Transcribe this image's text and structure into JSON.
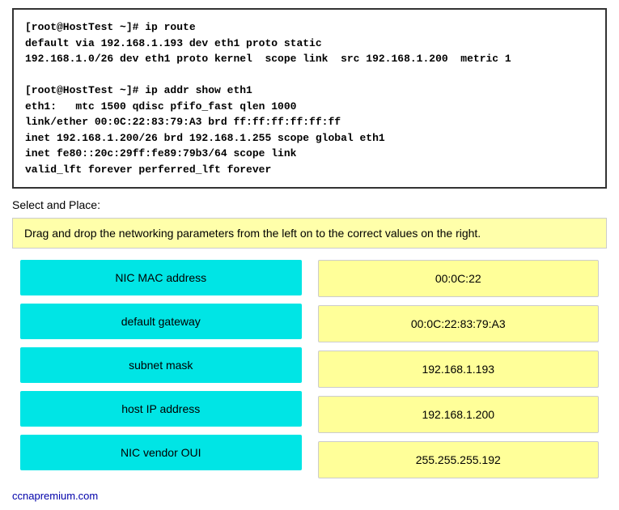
{
  "terminal": {
    "content": "[root@HostTest ~]# ip route\ndefault via 192.168.1.193 dev eth1 proto static\n192.168.1.0/26 dev eth1 proto kernel  scope link  src 192.168.1.200  metric 1\n\n[root@HostTest ~]# ip addr show eth1\neth1:   mtc 1500 qdisc pfifo_fast qlen 1000\nlink/ether 00:0C:22:83:79:A3 brd ff:ff:ff:ff:ff:ff\ninet 192.168.1.200/26 brd 192.168.1.255 scope global eth1\ninet fe80::20c:29ff:fe89:79b3/64 scope link\nvalid_lft forever perferred_lft forever"
  },
  "select_place_label": "Select and Place:",
  "instruction": "Drag and drop the networking parameters from the left on to the correct values on the right.",
  "left_items": [
    {
      "id": "nic-mac",
      "label": "NIC MAC address"
    },
    {
      "id": "default-gateway",
      "label": "default gateway"
    },
    {
      "id": "subnet-mask",
      "label": "subnet mask"
    },
    {
      "id": "host-ip",
      "label": "host IP address"
    },
    {
      "id": "nic-vendor-oui",
      "label": "NIC vendor OUI"
    }
  ],
  "right_items": [
    {
      "id": "val-1",
      "value": "00:0C:22"
    },
    {
      "id": "val-2",
      "value": "00:0C:22:83:79:A3"
    },
    {
      "id": "val-3",
      "value": "192.168.1.193"
    },
    {
      "id": "val-4",
      "value": "192.168.1.200"
    },
    {
      "id": "val-5",
      "value": "255.255.255.192"
    }
  ],
  "footer": {
    "text": "ccnapremium.com"
  }
}
